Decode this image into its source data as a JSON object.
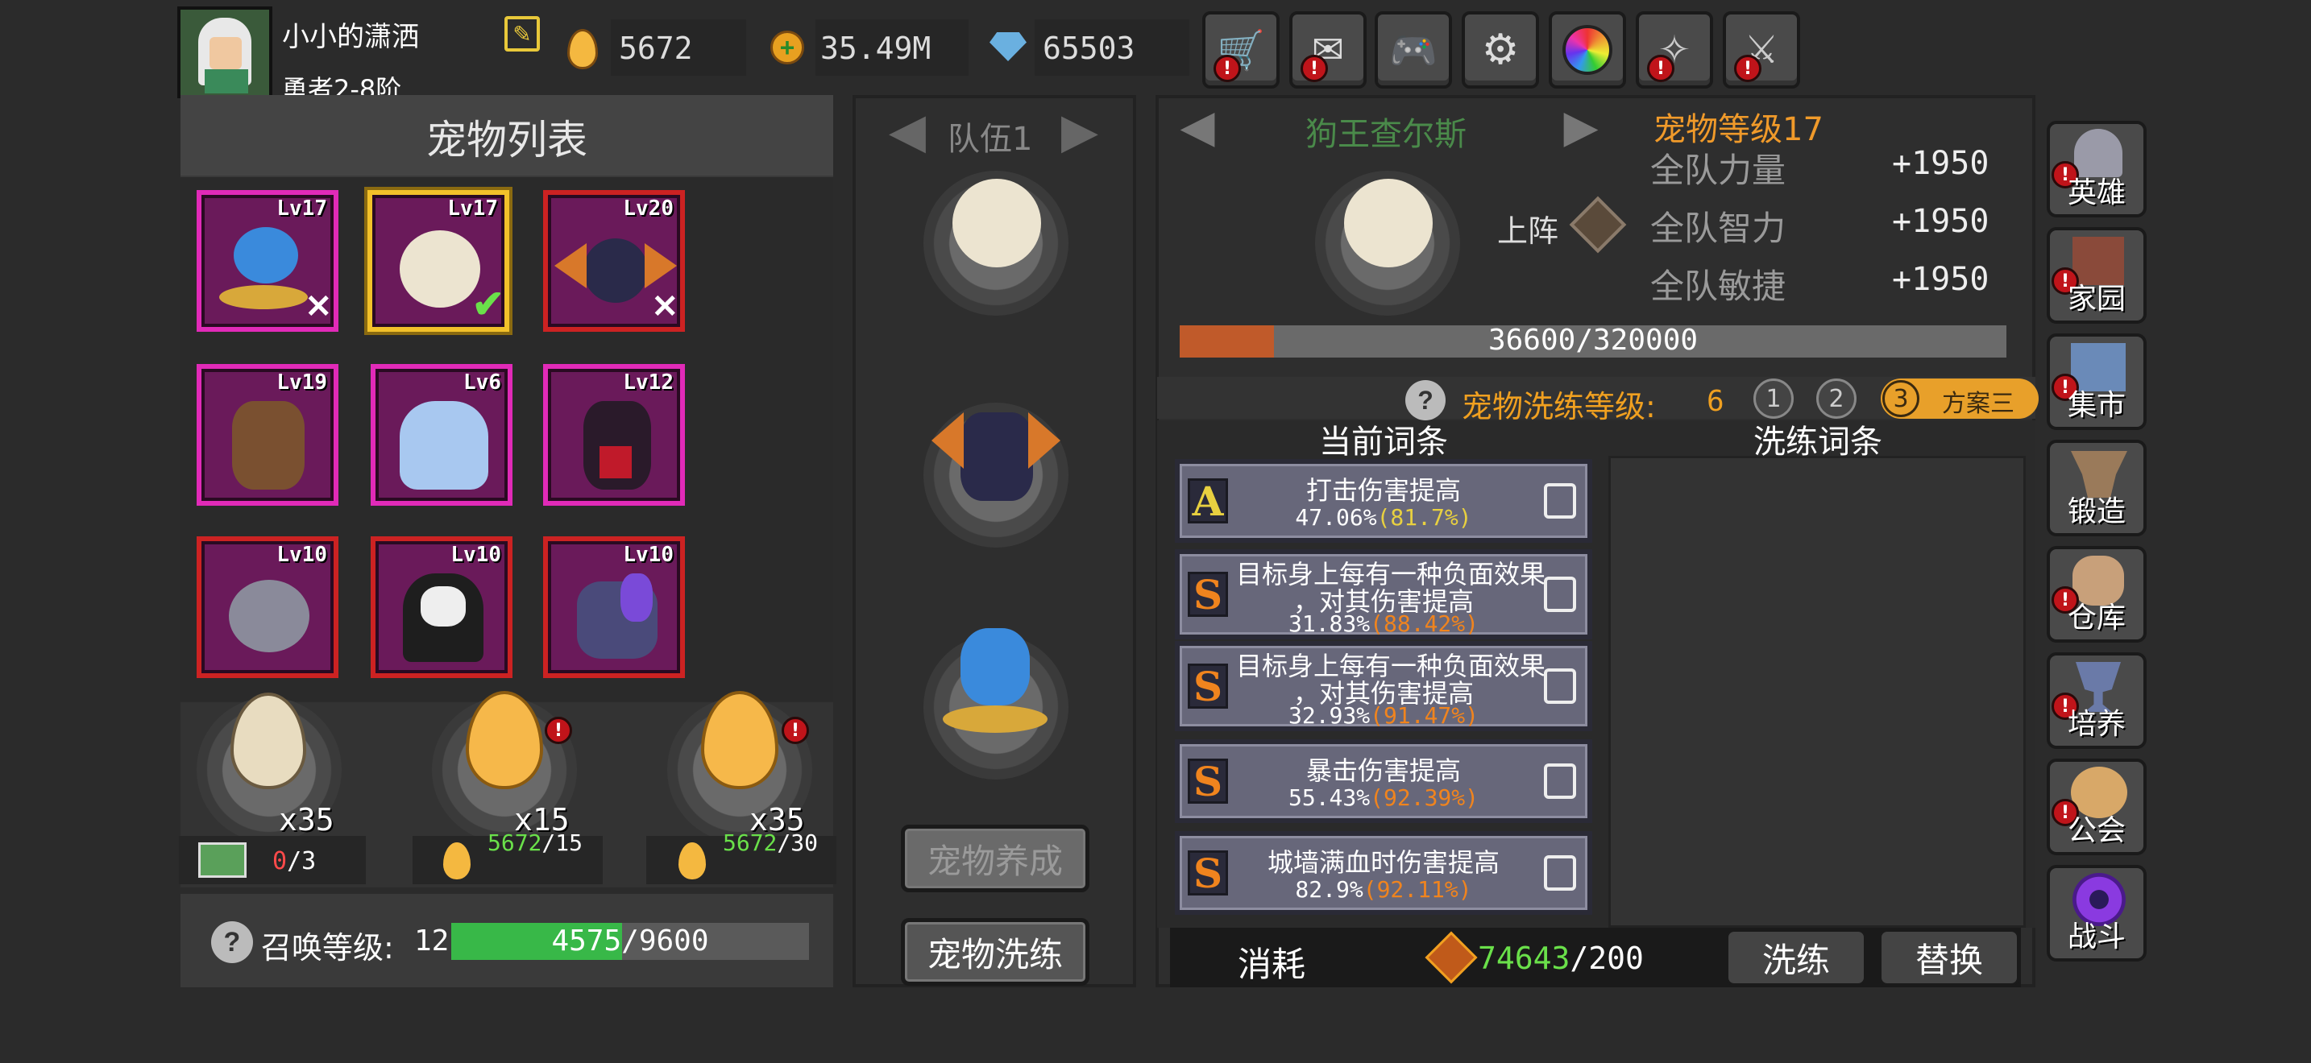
{
  "player": {
    "name": "小小的潇洒",
    "rank": "勇者2-8阶"
  },
  "currency": {
    "eggs": "5672",
    "gold": "35.49M",
    "gems": "65503"
  },
  "top_icons": [
    {
      "name": "shop-cart-icon",
      "alert": "!"
    },
    {
      "name": "mail-icon",
      "alert": "!"
    },
    {
      "name": "gamepad-icon",
      "alert": ""
    },
    {
      "name": "settings-gear-icon",
      "alert": ""
    },
    {
      "name": "color-wheel-icon",
      "alert": ""
    },
    {
      "name": "feather-icon",
      "alert": "!"
    },
    {
      "name": "swords-icon",
      "alert": "!"
    }
  ],
  "pet_list": {
    "title": "宠物列表",
    "pets": [
      {
        "level": "Lv17",
        "name": "genie-lamp-pet"
      },
      {
        "level": "Lv17",
        "name": "white-dog-pet"
      },
      {
        "level": "Lv20",
        "name": "bat-pet"
      },
      {
        "level": "Lv19",
        "name": "tree-pet"
      },
      {
        "level": "Lv6",
        "name": "ice-ghost-pet"
      },
      {
        "level": "Lv12",
        "name": "dark-witch-pet"
      },
      {
        "level": "Lv10",
        "name": "gray-bat-pet"
      },
      {
        "level": "Lv10",
        "name": "reaper-pet"
      },
      {
        "level": "Lv10",
        "name": "unicorn-pet"
      }
    ]
  },
  "eggs": [
    {
      "count": "x35",
      "cost_used": "0",
      "cost_total": "/3",
      "color": "#e8dcc0"
    },
    {
      "count": "x15",
      "cost_have": "5672",
      "cost_total": "/15",
      "color": "#f6b84a",
      "alert": "!"
    },
    {
      "count": "x35",
      "cost_have": "5672",
      "cost_total": "/30",
      "color": "#f6b84a",
      "alert": "!"
    }
  ],
  "summon": {
    "label": "召唤等级:",
    "level": "12",
    "progress_text": "4575/9600",
    "progress": 0.4766
  },
  "team": {
    "title": "队伍1"
  },
  "team_buttons": {
    "train": "宠物养成",
    "refine": "宠物洗练"
  },
  "pet_detail": {
    "name": "狗王查尔斯",
    "level": "宠物等级17",
    "deploy": "上阵",
    "stats": [
      {
        "label": "全队力量",
        "value": "+1950"
      },
      {
        "label": "全队智力",
        "value": "+1950"
      },
      {
        "label": "全队敏捷",
        "value": "+1950"
      }
    ],
    "exp_text": "36600/320000",
    "exp_progress": 0.114
  },
  "refine": {
    "level_label": "宠物洗练等级:",
    "level_value": "6",
    "plans": [
      "1",
      "2",
      "3"
    ],
    "active_plan_name": "方案三",
    "current_title": "当前词条",
    "refine_title": "洗练词条",
    "affixes": [
      {
        "grade": "A",
        "name1": "打击伤害提高",
        "name2": "",
        "value": "47.06%",
        "max": "(81.7%)",
        "grade_color": "#e8d040"
      },
      {
        "grade": "S",
        "name1": "目标身上每有一种负面效果",
        "name2": "，对其伤害提高",
        "value": "31.83%",
        "max": "(88.42%)",
        "grade_color": "#f0841e"
      },
      {
        "grade": "S",
        "name1": "目标身上每有一种负面效果",
        "name2": "，对其伤害提高",
        "value": "32.93%",
        "max": "(91.47%)",
        "grade_color": "#f0841e"
      },
      {
        "grade": "S",
        "name1": "暴击伤害提高",
        "name2": "",
        "value": "55.43%",
        "max": "(92.39%)",
        "grade_color": "#f0841e"
      },
      {
        "grade": "S",
        "name1": "城墙满血时伤害提高",
        "name2": "",
        "value": "82.9%",
        "max": "(92.11%)",
        "grade_color": "#f0841e"
      }
    ],
    "cost_label": "消耗",
    "cost_have": "74643",
    "cost_need": "/200",
    "btn_refine": "洗练",
    "btn_replace": "替换"
  },
  "side_menu": [
    "英雄",
    "家园",
    "集市",
    "锻造",
    "仓库",
    "培养",
    "公会",
    "战斗"
  ]
}
